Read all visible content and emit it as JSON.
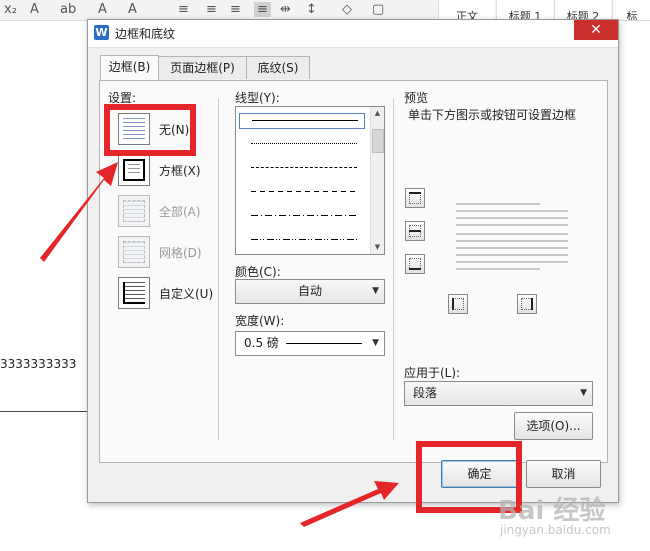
{
  "background": {
    "style_labels": [
      "正文",
      "标题 1",
      "标题 2",
      "标"
    ],
    "doc_text": "3333333333"
  },
  "dialog": {
    "title": "边框和底纹",
    "app_icon_letter": "W",
    "close_glyph": "✕",
    "tabs": [
      {
        "label": "边框(B)",
        "active": true
      },
      {
        "label": "页面边框(P)",
        "active": false
      },
      {
        "label": "底纹(S)",
        "active": false
      }
    ],
    "settings": {
      "label": "设置:",
      "items": [
        {
          "label": "无(N)",
          "enabled": true
        },
        {
          "label": "方框(X)",
          "enabled": true
        },
        {
          "label": "全部(A)",
          "enabled": false
        },
        {
          "label": "网格(D)",
          "enabled": false
        },
        {
          "label": "自定义(U)",
          "enabled": true
        }
      ]
    },
    "line_style": {
      "label": "线型(Y):"
    },
    "color": {
      "label": "颜色(C):",
      "value": "自动"
    },
    "width": {
      "label": "宽度(W):",
      "value": "0.5 磅"
    },
    "preview": {
      "label": "预览",
      "hint": "单击下方图示或按钮可设置边框"
    },
    "apply_to": {
      "label": "应用于(L):",
      "value": "段落"
    },
    "buttons": {
      "options": "选项(O)...",
      "ok": "确定",
      "cancel": "取消"
    }
  },
  "watermark": {
    "brand": "Bai 经验",
    "url": "jingyan.baidu.com"
  },
  "colors": {
    "highlight": "#e4252a",
    "accent": "#2b6cc4"
  }
}
